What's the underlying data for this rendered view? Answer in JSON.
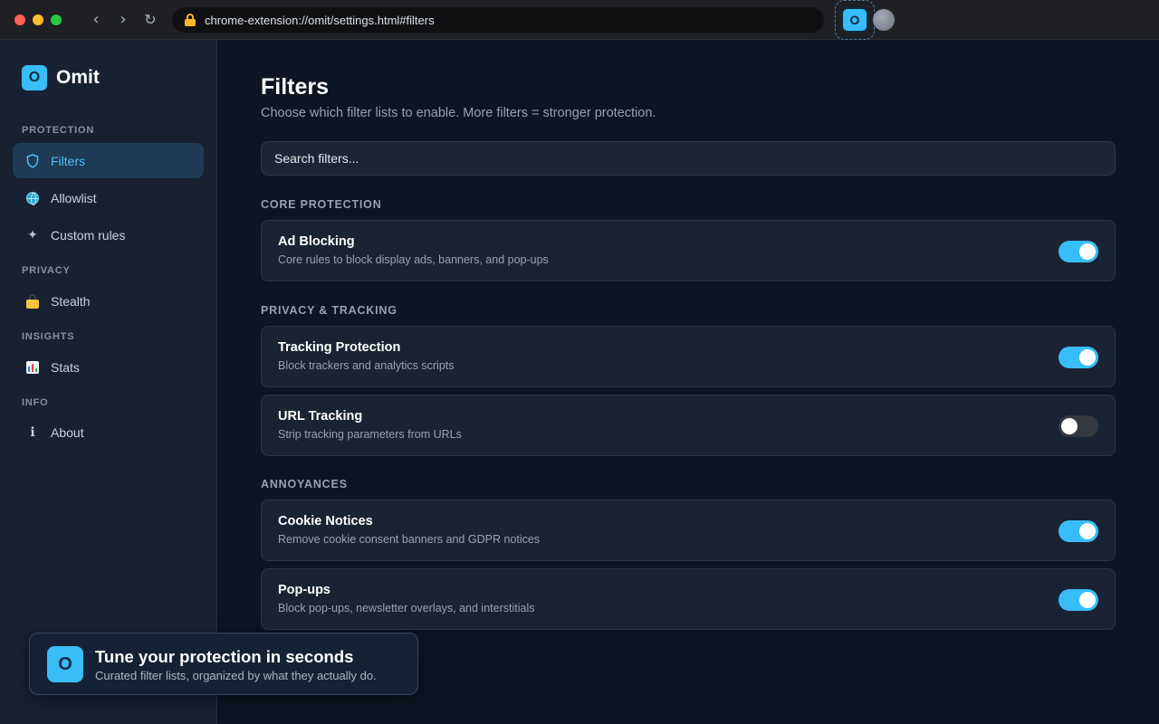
{
  "browser": {
    "url": "chrome-extension://omit/settings.html#filters",
    "back_glyph": "‹",
    "forward_glyph": "›",
    "reload_glyph": "↻",
    "extension_letter": "O"
  },
  "sidebar": {
    "brand_letter": "O",
    "brand_name": "Omit",
    "sections": [
      {
        "label": "PROTECTION",
        "items": [
          {
            "label": "Filters",
            "icon": "shield-icon",
            "active": true
          },
          {
            "label": "Allowlist",
            "icon": "globe-icon"
          },
          {
            "label": "Custom rules",
            "icon": "sparkle-icon"
          }
        ]
      },
      {
        "label": "PRIVACY",
        "items": [
          {
            "label": "Stealth",
            "icon": "lock-icon"
          }
        ]
      },
      {
        "label": "INSIGHTS",
        "items": [
          {
            "label": "Stats",
            "icon": "bar-chart-icon"
          }
        ]
      },
      {
        "label": "INFO",
        "items": [
          {
            "label": "About",
            "icon": "info-icon"
          }
        ]
      }
    ]
  },
  "main": {
    "title": "Filters",
    "subtitle": "Choose which filter lists to enable. More filters = stronger protection.",
    "search_placeholder": "Search filters...",
    "groups": [
      {
        "label": "CORE PROTECTION",
        "filters": [
          {
            "title": "Ad Blocking",
            "desc": "Core rules to block display ads, banners, and pop-ups",
            "enabled": true
          }
        ]
      },
      {
        "label": "PRIVACY & TRACKING",
        "filters": [
          {
            "title": "Tracking Protection",
            "desc": "Block trackers and analytics scripts",
            "enabled": true
          },
          {
            "title": "URL Tracking",
            "desc": "Strip tracking parameters from URLs",
            "enabled": false
          }
        ]
      },
      {
        "label": "ANNOYANCES",
        "filters": [
          {
            "title": "Cookie Notices",
            "desc": "Remove cookie consent banners and GDPR notices",
            "enabled": true
          },
          {
            "title": "Pop-ups",
            "desc": "Block pop-ups, newsletter overlays, and interstitials",
            "enabled": true
          }
        ]
      }
    ]
  },
  "toast": {
    "logo_letter": "O",
    "title": "Tune your protection in seconds",
    "subtitle": "Curated filter lists, organized by what they actually do."
  },
  "colors": {
    "accent": "#38bdf8",
    "background": "#0d1422",
    "sidebar": "#172132",
    "card": "#1a2333"
  }
}
